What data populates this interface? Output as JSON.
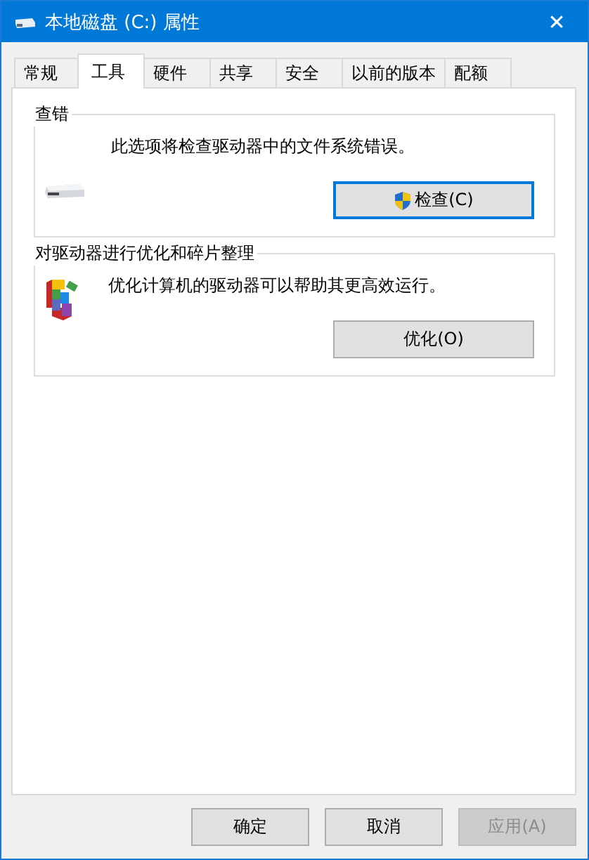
{
  "window": {
    "title": "本地磁盘 (C:) 属性",
    "close": "✕"
  },
  "tabs": [
    {
      "label": "常规",
      "selected": false
    },
    {
      "label": "工具",
      "selected": true
    },
    {
      "label": "硬件",
      "selected": false
    },
    {
      "label": "共享",
      "selected": false
    },
    {
      "label": "安全",
      "selected": false
    },
    {
      "label": "以前的版本",
      "selected": false
    },
    {
      "label": "配额",
      "selected": false
    }
  ],
  "groups": [
    {
      "title": "查错",
      "kind": "check",
      "description": "此选项将检查驱动器中的文件系统错误。",
      "button": {
        "label": "检查(C)",
        "shield": true,
        "focused": true
      }
    },
    {
      "title": "对驱动器进行优化和碎片整理",
      "kind": "optimize",
      "description": "优化计算机的驱动器可以帮助其更高效运行。",
      "button": {
        "label": "优化(O)",
        "shield": false,
        "focused": false
      }
    }
  ],
  "buttons": [
    {
      "label": "确定",
      "disabled": false
    },
    {
      "label": "取消",
      "disabled": false
    },
    {
      "label": "应用(A)",
      "disabled": true
    }
  ]
}
